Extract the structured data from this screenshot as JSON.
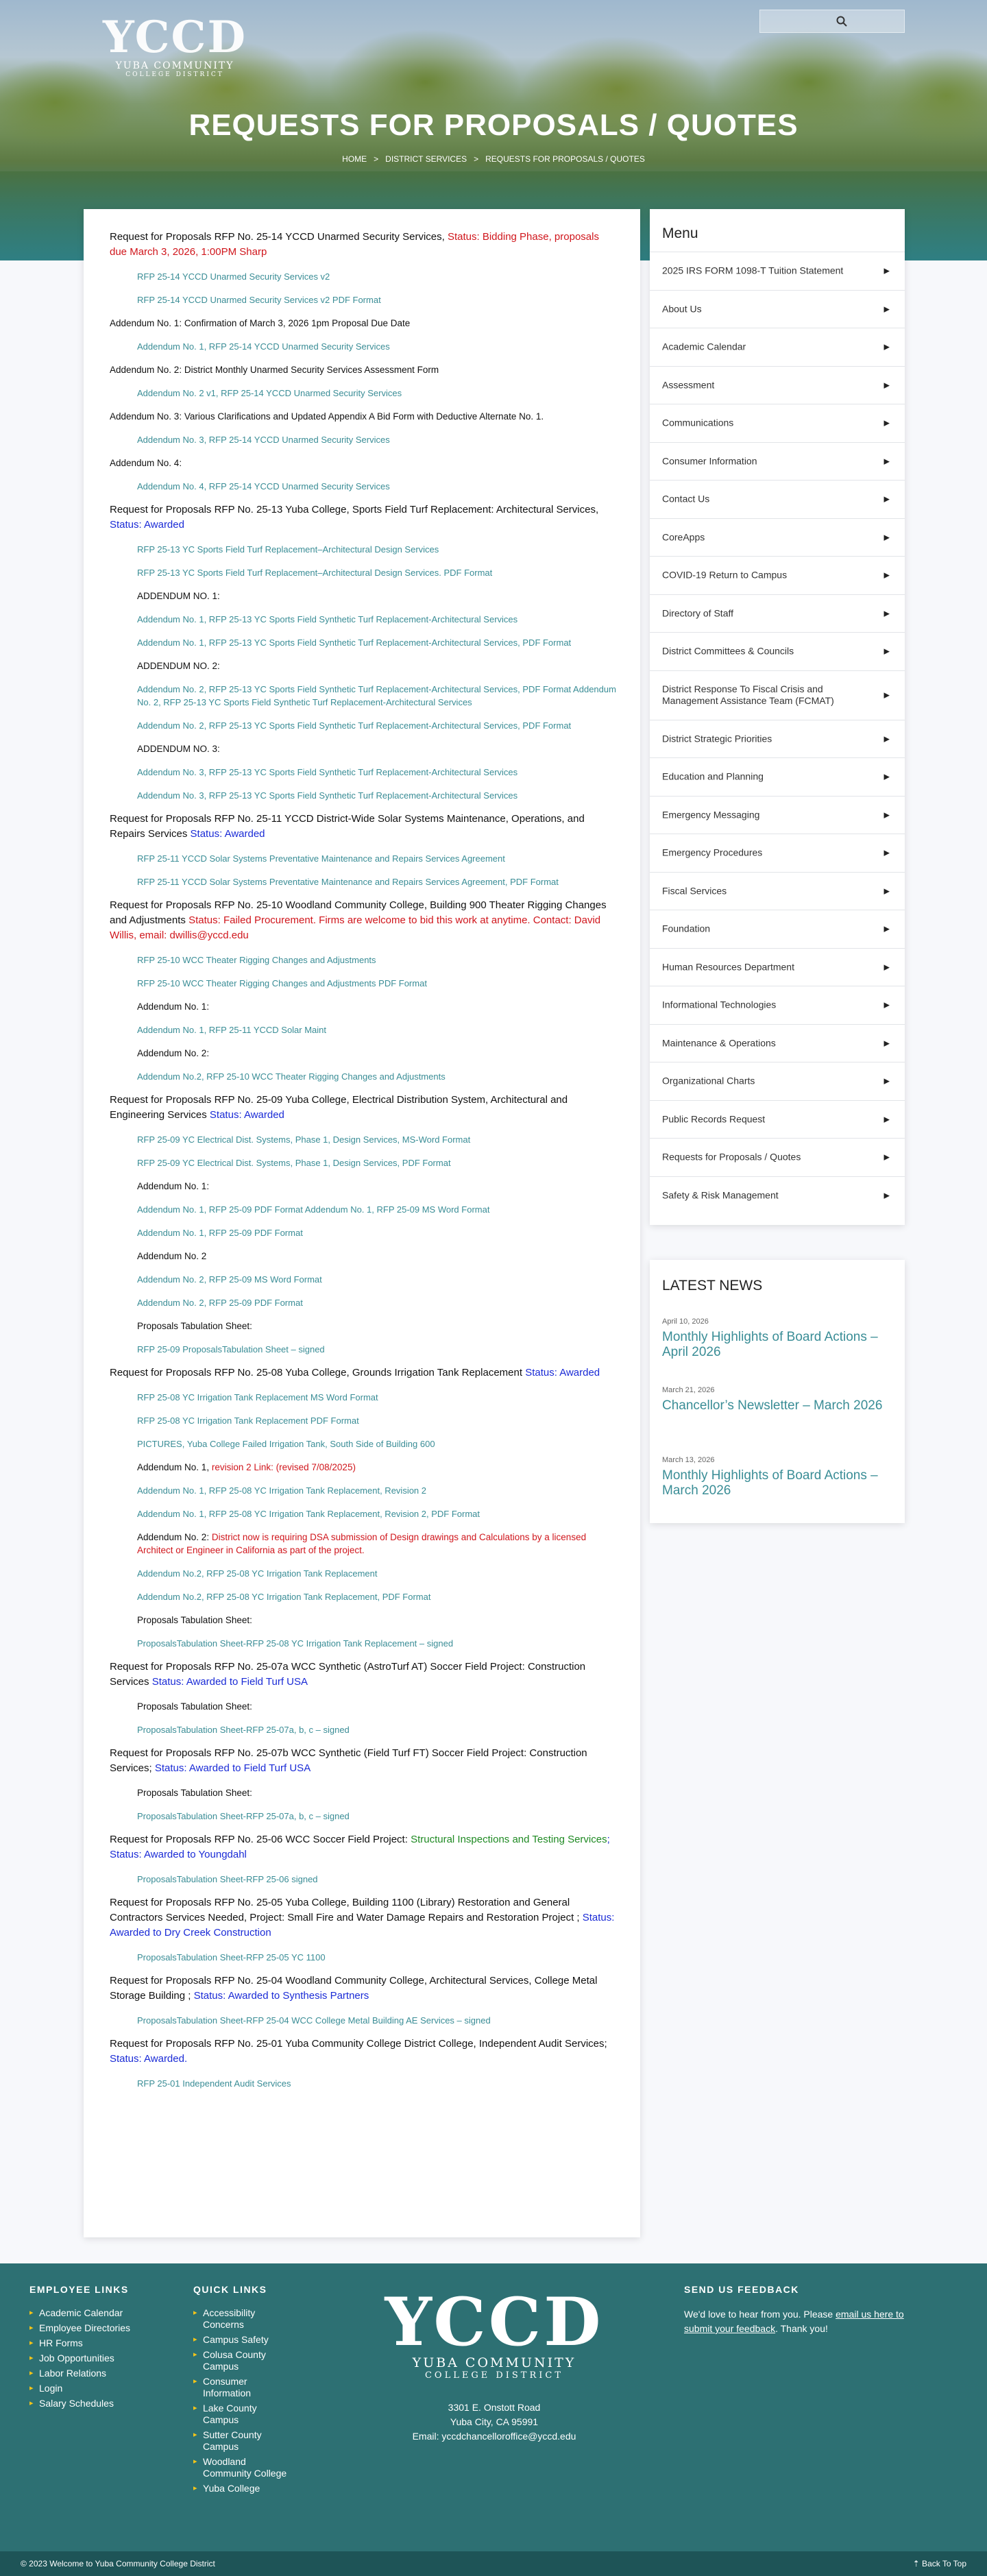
{
  "header": {
    "logo": {
      "mark": "YCCD",
      "line1": "YUBA COMMUNITY",
      "line2": "COLLEGE DISTRICT"
    },
    "search_placeholder": ""
  },
  "page_title": "REQUESTS FOR PROPOSALS / QUOTES",
  "breadcrumb": [
    "HOME",
    ">",
    "DISTRICT SERVICES",
    ">",
    "REQUESTS FOR PROPOSALS / QUOTES"
  ],
  "rfps": [
    {
      "title": "Request for Proposals RFP No. 25-14 YCCD Unarmed Security Services, ",
      "status": "Status: Bidding Phase, proposals due March 3, 2026, 1:00PM Sharp",
      "status_color": "red",
      "items": [
        {
          "t": "link",
          "v": "RFP 25-14 YCCD Unarmed Security Services v2"
        },
        {
          "t": "link",
          "v": "RFP 25-14 YCCD Unarmed Security Services v2 PDF Format"
        },
        {
          "t": "label",
          "v": "Addendum No. 1: Confirmation of March 3, 2026 1pm Proposal Due Date"
        },
        {
          "t": "link",
          "v": "Addendum No. 1, RFP 25-14 YCCD Unarmed Security Services"
        },
        {
          "t": "label",
          "v": "Addendum No. 2: District Monthly Unarmed Security Services Assessment Form"
        },
        {
          "t": "link",
          "v": "Addendum No. 2 v1, RFP 25-14 YCCD Unarmed Security Services"
        },
        {
          "t": "label",
          "v": "Addendum No. 3: Various Clarifications and Updated Appendix A Bid Form with Deductive Alternate No. 1."
        },
        {
          "t": "link",
          "v": "Addendum No. 3, RFP 25-14 YCCD Unarmed Security Services"
        },
        {
          "t": "label",
          "v": "Addendum No. 4:"
        },
        {
          "t": "link",
          "v": "Addendum No. 4, RFP 25-14 YCCD Unarmed Security Services"
        }
      ]
    },
    {
      "title": "Request for Proposals RFP No. 25-13 Yuba College, Sports Field Turf Replacement:  Architectural Services, ",
      "status": "Status: Awarded",
      "status_color": "blue",
      "items": [
        {
          "t": "link",
          "v": "RFP 25-13 YC Sports Field Turf Replacement–Architectural Design Services"
        },
        {
          "t": "link",
          "v": "RFP 25-13 YC Sports Field Turf Replacement–Architectural Design Services. PDF Format"
        },
        {
          "t": "label_in",
          "v": "ADDENDUM NO. 1:"
        },
        {
          "t": "link",
          "v": "Addendum No. 1, RFP 25-13 YC Sports Field Synthetic Turf Replacement-Architectural Services"
        },
        {
          "t": "link",
          "v": "Addendum No. 1, RFP 25-13 YC Sports Field Synthetic Turf Replacement-Architectural Services, PDF Format"
        },
        {
          "t": "label_in",
          "v": "ADDENDUM NO. 2:"
        },
        {
          "t": "link",
          "v": "Addendum No. 2, RFP 25-13 YC Sports Field Synthetic Turf Replacement-Architectural Services, PDF Format Addendum No. 2, RFP 25-13 YC Sports Field Synthetic Turf Replacement-Architectural Services"
        },
        {
          "t": "link",
          "v": "Addendum No. 2, RFP 25-13 YC Sports Field Synthetic Turf Replacement-Architectural Services, PDF Format"
        },
        {
          "t": "label_in",
          "v": "ADDENDUM NO. 3:"
        },
        {
          "t": "link",
          "v": "Addendum No. 3, RFP 25-13 YC Sports Field Synthetic Turf Replacement-Architectural Services"
        },
        {
          "t": "link",
          "v": "Addendum No. 3, RFP 25-13 YC Sports Field Synthetic Turf Replacement-Architectural Services"
        }
      ]
    },
    {
      "title": "Request for Proposals RFP No. 25-11 YCCD District-Wide Solar Systems Maintenance, Operations, and Repairs Services  ",
      "status": "Status: Awarded",
      "status_color": "blue",
      "items": [
        {
          "t": "link",
          "v": "RFP 25-11 YCCD Solar Systems Preventative Maintenance and Repairs Services Agreement"
        },
        {
          "t": "link",
          "v": "RFP 25-11 YCCD Solar Systems Preventative Maintenance and Repairs Services Agreement, PDF Format"
        }
      ]
    },
    {
      "title": "Request for Proposals RFP No. 25-10 Woodland Community College, Building 900 Theater Rigging Changes and Adjustments  ",
      "status": "Status: Failed Procurement. Firms are welcome to bid this work at anytime.  Contact: David Willis, email: dwillis@yccd.edu",
      "status_color": "red",
      "items": [
        {
          "t": "link",
          "v": "RFP 25-10 WCC Theater Rigging Changes and Adjustments"
        },
        {
          "t": "link",
          "v": "RFP 25-10 WCC Theater Rigging Changes and Adjustments PDF Format"
        },
        {
          "t": "label_in",
          "v": "Addendum No. 1:"
        },
        {
          "t": "link",
          "v": "Addendum No. 1, RFP 25-11 YCCD Solar Maint"
        },
        {
          "t": "label_in",
          "v": "Addendum No. 2:"
        },
        {
          "t": "link",
          "v": "Addendum No.2, RFP 25-10 WCC Theater Rigging Changes and Adjustments"
        }
      ]
    },
    {
      "title": "Request for Proposals RFP No. 25-09 Yuba College, Electrical Distribution System, Architectural and Engineering Services  ",
      "status": "Status: Awarded",
      "status_color": "blue",
      "items": [
        {
          "t": "link",
          "v": "RFP 25-09 YC Electrical Dist. Systems, Phase 1, Design Services, MS-Word Format"
        },
        {
          "t": "link",
          "v": "RFP 25-09 YC Electrical Dist. Systems, Phase 1, Design Services, PDF Format"
        },
        {
          "t": "label_in",
          "v": "Addendum No. 1:"
        },
        {
          "t": "link",
          "v": "Addendum No. 1, RFP 25-09 PDF Format Addendum No. 1, RFP 25-09 MS Word Format"
        },
        {
          "t": "link",
          "v": "Addendum No. 1, RFP 25-09 PDF Format"
        },
        {
          "t": "label_in",
          "v": "Addendum No. 2"
        },
        {
          "t": "link",
          "v": "Addendum No. 2, RFP 25-09 MS Word Format"
        },
        {
          "t": "link",
          "v": "Addendum No. 2, RFP 25-09 PDF Format"
        },
        {
          "t": "label_in",
          "v": "Proposals Tabulation Sheet:"
        },
        {
          "t": "link",
          "v": "RFP 25-09 ProposalsTabulation Sheet – signed"
        }
      ]
    },
    {
      "title": "Request for Proposals RFP No. 25-08 Yuba College, Grounds Irrigation Tank Replacement  ",
      "status": "Status: Awarded",
      "status_color": "blue",
      "items": [
        {
          "t": "link",
          "v": "RFP 25-08 YC Irrigation Tank Replacement MS Word Format"
        },
        {
          "t": "link",
          "v": "RFP 25-08 YC Irrigation Tank Replacement PDF Format"
        },
        {
          "t": "link",
          "v": "PICTURES, Yuba College Failed Irrigation Tank, South Side of Building 600"
        },
        {
          "t": "label_in_red",
          "v": "Addendum No. 1, ",
          "red": "revision 2 Link: (revised 7/08/2025)"
        },
        {
          "t": "link",
          "v": "Addendum No. 1, RFP 25-08 YC Irrigation Tank Replacement, Revision 2"
        },
        {
          "t": "link",
          "v": "Addendum No. 1, RFP 25-08 YC Irrigation Tank Replacement, Revision 2, PDF Format"
        },
        {
          "t": "label_in_red",
          "v": "Addendum No. 2: ",
          "red": "District now is requiring DSA submission of Design drawings and Calculations by a licensed Architect or Engineer in California as part of the project."
        },
        {
          "t": "link",
          "v": "Addendum No.2, RFP 25-08 YC Irrigation Tank Replacement"
        },
        {
          "t": "link",
          "v": "Addendum No.2, RFP 25-08 YC Irrigation Tank Replacement, PDF Format"
        },
        {
          "t": "label_in",
          "v": "Proposals Tabulation Sheet:"
        },
        {
          "t": "link",
          "v": "ProposalsTabulation Sheet-RFP 25-08 YC Irrigation Tank Replacement – signed"
        }
      ]
    },
    {
      "title": "Request for Proposals RFP No. 25-07a WCC Synthetic (AstroTurf AT) Soccer Field Project: Construction Services   ",
      "status": "Status: Awarded to Field Turf USA",
      "status_color": "blue",
      "items": [
        {
          "t": "label_in",
          "v": "Proposals Tabulation Sheet:"
        },
        {
          "t": "link",
          "v": "ProposalsTabulation Sheet-RFP 25-07a, b, c – signed"
        }
      ]
    },
    {
      "title": "Request for Proposals RFP No. 25-07b WCC Synthetic (Field Turf FT) Soccer Field Project: Construction Services; ",
      "status": "Status: Awarded to Field Turf USA",
      "status_color": "blue",
      "items": [
        {
          "t": "label_in",
          "v": "Proposals Tabulation Sheet:"
        },
        {
          "t": "link",
          "v": "ProposalsTabulation Sheet-RFP 25-07a, b, c – signed"
        }
      ]
    },
    {
      "title": "Request for Proposals RFP No. 25-06 WCC Soccer Field Project: ",
      "status_green": "Structural Inspections and Testing Services",
      "status": "; Status: Awarded to Youngdahl",
      "status_color": "blue",
      "items": [
        {
          "t": "link",
          "v": "ProposalsTabulation Sheet-RFP 25-06 signed"
        }
      ]
    },
    {
      "title": "Request for Proposals RFP No. 25-05 Yuba College, Building 1100 (Library) Restoration and General Contractors Services Needed, Project: Small Fire and Water Damage Repairs and Restoration Project ; ",
      "status": "Status: Awarded to Dry Creek Construction",
      "status_color": "blue",
      "items": [
        {
          "t": "link",
          "v": "ProposalsTabulation Sheet-RFP 25-05 YC 1100"
        }
      ]
    },
    {
      "title": "Request for Proposals RFP No. 25-04 Woodland Community College, Architectural Services, College Metal Storage Building ;  ",
      "status": "Status: Awarded to Synthesis Partners",
      "status_color": "blue",
      "items": [
        {
          "t": "link",
          "v": "ProposalsTabulation Sheet-RFP 25-04 WCC College Metal Building AE Services – signed"
        }
      ]
    },
    {
      "title": "Request for Proposals RFP No. 25-01 Yuba Community College District College, Independent Audit Services;  ",
      "status": "Status: Awarded.",
      "status_color": "blue",
      "items": [
        {
          "t": "link",
          "v": "RFP 25-01 Independent Audit Services"
        }
      ]
    }
  ],
  "sidebar": {
    "heading": "Menu",
    "arrow": "▶",
    "items": [
      "2025 IRS FORM 1098-T Tuition Statement",
      "About Us",
      "Academic Calendar",
      "Assessment",
      "Communications",
      "Consumer Information",
      "Contact Us",
      "CoreApps",
      "COVID-19 Return to Campus",
      "Directory of Staff",
      "District Committees & Councils",
      "District Response To Fiscal Crisis and Management Assistance Team (FCMAT)",
      "District Strategic Priorities",
      "Education and Planning",
      "Emergency Messaging",
      "Emergency Procedures",
      "Fiscal Services",
      "Foundation",
      "Human Resources Department",
      "Informational Technologies",
      "Maintenance & Operations",
      "Organizational Charts",
      "Public Records Request",
      "Requests for Proposals / Quotes",
      "Safety & Risk Management"
    ]
  },
  "news": {
    "heading": "LATEST NEWS",
    "items": [
      {
        "date": "April 10, 2026",
        "title": "Monthly Highlights of Board Actions – April 2026"
      },
      {
        "date": "March 21, 2026",
        "title": "Chancellor’s Newsletter – March 2026"
      },
      {
        "date": "March 13, 2026",
        "title": "Monthly Highlights of Board Actions – March 2026"
      }
    ]
  },
  "footer": {
    "employee_heading": "EMPLOYEE LINKS",
    "employee_links": [
      "Academic Calendar",
      "Employee Directories",
      "HR Forms",
      "Job Opportunities",
      "Labor Relations",
      "Login",
      "Salary Schedules"
    ],
    "quick_heading": "QUICK LINKS",
    "quick_links": [
      "Accessibility Concerns",
      "Campus Safety",
      "Colusa County Campus",
      "Consumer Information",
      "Lake County Campus",
      "Sutter County Campus",
      "Woodland Community College",
      "Yuba College"
    ],
    "logo": {
      "mark": "YCCD",
      "line1": "YUBA COMMUNITY",
      "line2": "COLLEGE DISTRICT"
    },
    "address": [
      "3301 E. Onstott Road",
      "Yuba City, CA 95991",
      "Email: yccdchancelloroffice@yccd.edu"
    ],
    "feedback_heading": "SEND US FEEDBACK",
    "feedback_pre": "We'd love to hear from you. Please ",
    "feedback_link": "email us here to submit your feedback",
    "feedback_post": ". Thank you!",
    "copyright": "© 2023 Welcome to Yuba Community College District",
    "back_to_top": "⇡ Back To Top"
  },
  "colors": {
    "teal": "#2d7073",
    "link": "#3a8d96",
    "status_red": "#d0161c",
    "status_blue": "#1a2bd6",
    "status_green": "#1f8a23",
    "bullet": "#f5c518"
  }
}
